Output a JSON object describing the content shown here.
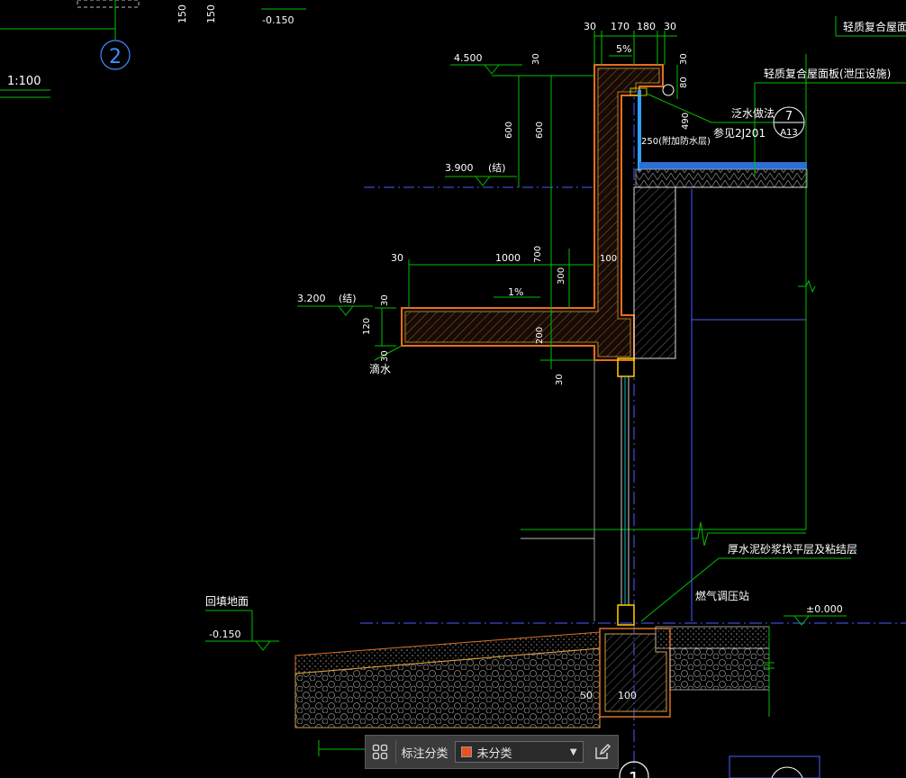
{
  "drawing": {
    "scale": "1:100",
    "grid_labels": [
      "2",
      "1"
    ],
    "detail_ref": {
      "number": "7",
      "sheet": "A13"
    },
    "elevations": [
      "4.500",
      "3.900",
      "3.200",
      "-0.150",
      "±0.000",
      "-0.150"
    ],
    "elevation_suffix": "(结)",
    "dims": {
      "top_left": [
        "150",
        "150"
      ],
      "top": [
        "30",
        "170",
        "180",
        "30"
      ],
      "slope_top": "5%",
      "parapet": [
        "30",
        "80",
        "30",
        "600",
        "600",
        "490"
      ],
      "ribbon": "250(附加防水层)",
      "canopy": [
        "30",
        "1000",
        "700",
        "100",
        "300",
        "30",
        "120",
        "30",
        "200",
        "30"
      ],
      "slope_canopy": "1%",
      "found": [
        "50",
        "100"
      ]
    },
    "notes": {
      "roof_panel_top": "轻质复合屋面板",
      "roof_panel": "轻质复合屋面板(泄压设施)",
      "flashing": "泛水做法",
      "flashing_ref": "参见2J201",
      "drip": "滴水",
      "mortar": "厚水泥砂浆找平层及粘结层",
      "gas_station": "燃气调压站",
      "ground": "回填地面"
    }
  },
  "toolbar": {
    "grid_icon": "grid-icon",
    "label": "标注分类",
    "selected": "未分类",
    "selected_color": "#e8521c",
    "edit_icon": "edit-icon"
  }
}
